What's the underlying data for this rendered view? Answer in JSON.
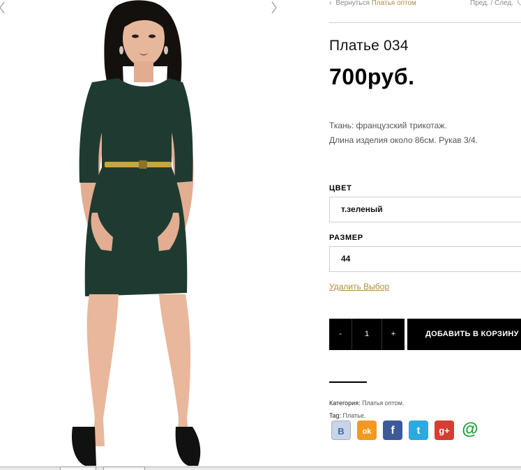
{
  "nav": {
    "back_chevron": "‹",
    "back_text": "Вернуться",
    "back_link": "Платья оптом",
    "prev_next": "Пред. / След."
  },
  "product": {
    "title": "Платье 034",
    "price": "700руб.",
    "desc_line1": "Ткань: французский трикотаж.",
    "desc_line2": "Длина изделия около 86см. Рукав 3/4."
  },
  "options": {
    "color_label": "ЦВЕТ",
    "color_value": "т.зеленый",
    "size_label": "РАЗМЕР",
    "size_value": "44",
    "reset_label": "Удалить Выбор"
  },
  "cart": {
    "minus": "-",
    "quantity": "1",
    "plus": "+",
    "add_label": "ДОБАВИТЬ В КОРЗИНУ"
  },
  "meta": {
    "category_label": "Категория:",
    "category_value": "Платья оптом.",
    "tag_label": "Tag:",
    "tag_value": "Платье."
  },
  "social": [
    {
      "name": "vkontakte-icon",
      "glyph": "B",
      "color": "#c9d4e6"
    },
    {
      "name": "odnoklassniki-icon",
      "glyph": "ok",
      "color": "#f39a1e"
    },
    {
      "name": "facebook-icon",
      "glyph": "f",
      "color": "#3b5a9a"
    },
    {
      "name": "twitter-icon",
      "glyph": "t",
      "color": "#2ba9e1"
    },
    {
      "name": "google-plus-icon",
      "glyph": "g+",
      "color": "#d73d32"
    },
    {
      "name": "mail-icon",
      "glyph": "@",
      "color": "#ffffff"
    }
  ],
  "colors": {
    "accent_link": "#b08a3e",
    "dress": "#1f3b31",
    "button_bg": "#000000"
  }
}
